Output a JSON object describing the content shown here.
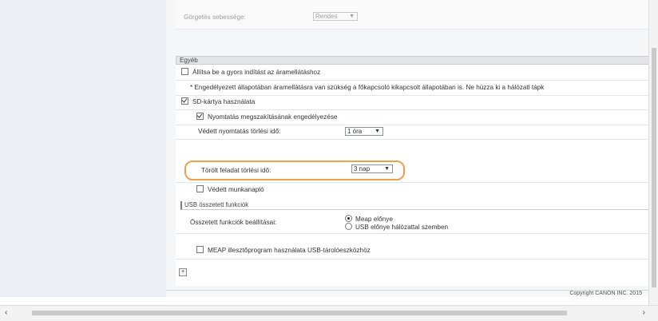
{
  "top_row": {
    "label": "Görgetés sebessége:",
    "value": "Rendes"
  },
  "egyeb": {
    "header": "Egyéb",
    "quick_start_label": "Állítsa be a gyors indítást az áramellátáshoz",
    "note": "* Engedélyezett állapotában áramellátásra van szükség a főkapcsoló kikapcsolt állapotában is. Ne húzza ki a hálózati tápk",
    "sd_label": "SD-kártya használata",
    "print_interrupt_label": "Nyomtatás megszakításának engedélyezése",
    "protected_print_delete_label": "Védett nyomtatás törlési idő:",
    "protected_print_delete_value": "1 óra",
    "deleted_job_delete_label": "Törölt feladat törlési idő:",
    "deleted_job_delete_value": "3 nap",
    "protected_log_label": "Védett munkanapló"
  },
  "usb": {
    "header": "USB összetett funkciók",
    "compound_label": "Összetett funkciók beállításai:",
    "option_meap": "Meap előnye",
    "option_usb": "USB előnye hálózattal szemben",
    "meap_driver_label": "MEAP illesztőprogram használata USB-tárolóeszközhöz"
  },
  "footer": {
    "copyright": "Copyright CANON INC. 2015"
  },
  "icons": {
    "expand": "expand-icon",
    "scroll_left": "chevron-left-icon",
    "scroll_right": "chevron-right-icon"
  },
  "colors": {
    "highlight": "#f0a04b",
    "section_header_bg": "#e3e5e8",
    "left_pane_bg": "#ebeef5"
  }
}
